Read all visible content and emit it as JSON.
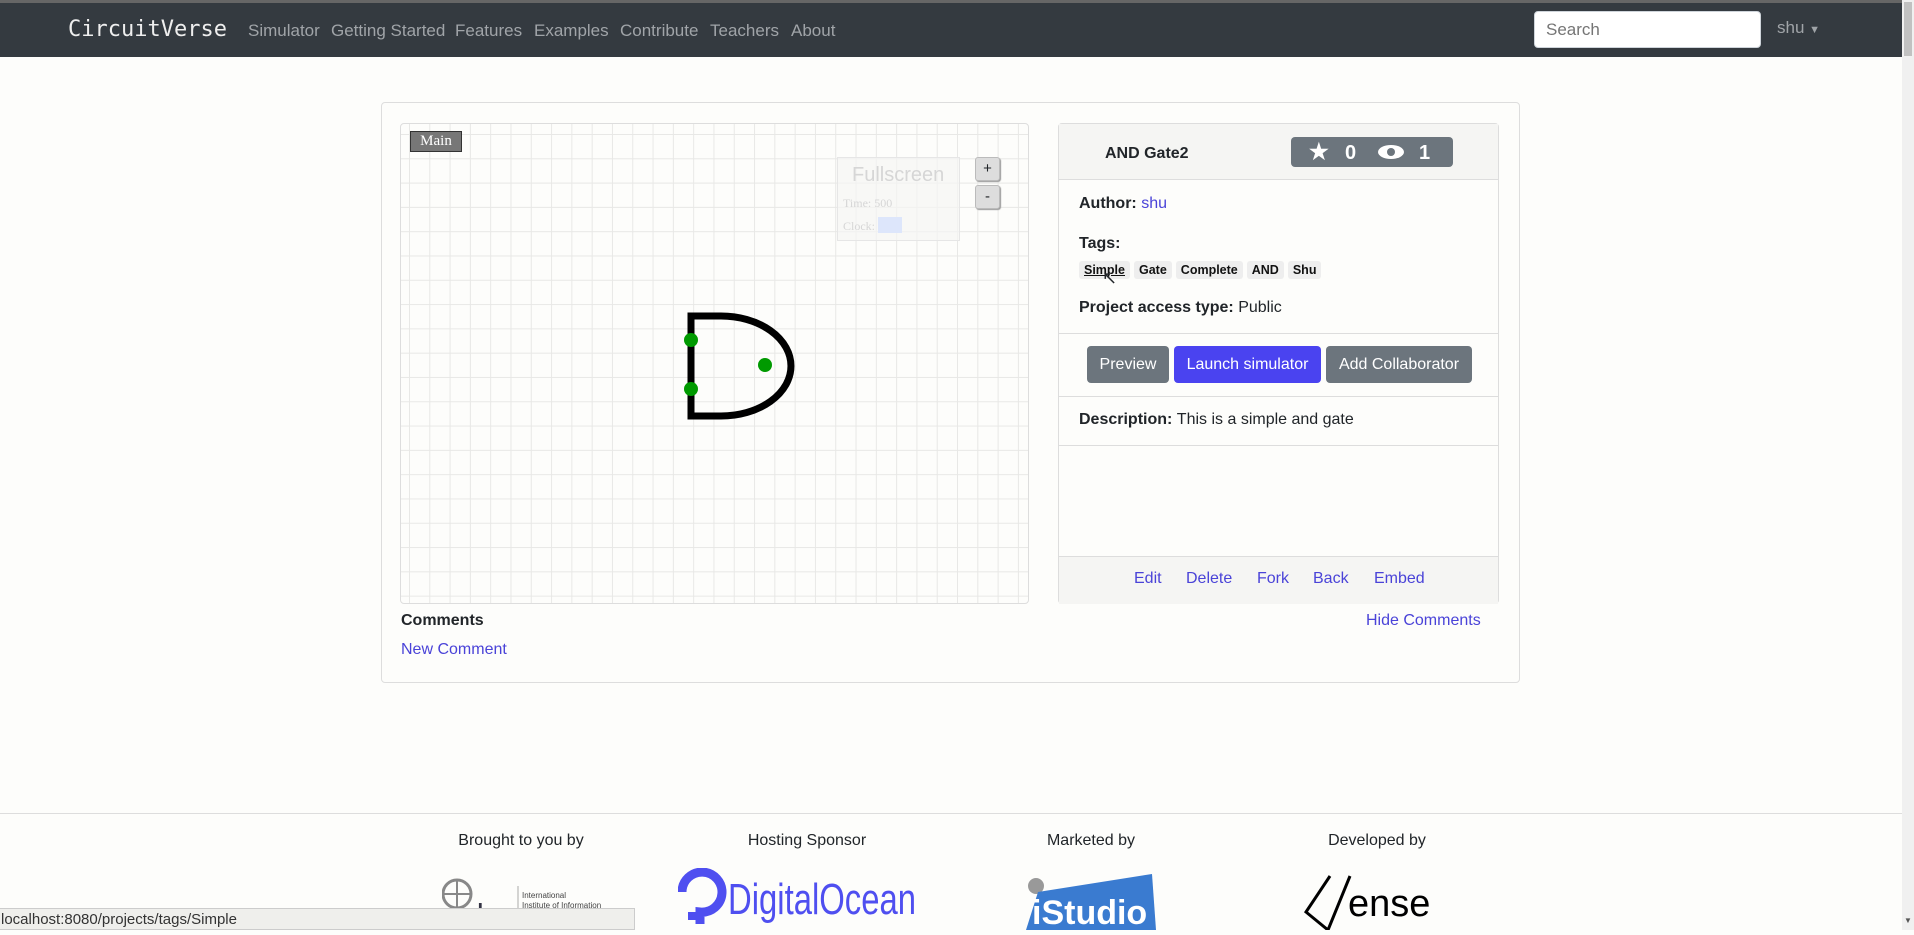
{
  "navbar": {
    "brand": "CircuitVerse",
    "items": [
      "Simulator",
      "Getting Started",
      "Features",
      "Examples",
      "Contribute",
      "Teachers",
      "About"
    ],
    "search_placeholder": "Search",
    "user": "shu"
  },
  "canvas": {
    "tab": "Main",
    "fullscreen": "Fullscreen",
    "time_label": "Time:",
    "time_value": "500",
    "clock_label": "Clock:",
    "zoom_in": "+",
    "zoom_out": "-"
  },
  "project": {
    "title": "AND Gate2",
    "stars": "0",
    "views": "1",
    "author_label": "Author:",
    "author": "shu",
    "tags_label": "Tags:",
    "tags": [
      "Simple",
      "Gate",
      "Complete",
      "AND",
      "Shu"
    ],
    "access_label": "Project access type:",
    "access": "Public",
    "description_label": "Description:",
    "description": "This is a simple and gate",
    "buttons": {
      "preview": "Preview",
      "launch": "Launch simulator",
      "collab": "Add Collaborator"
    },
    "footer_links": [
      "Edit",
      "Delete",
      "Fork",
      "Back",
      "Embed"
    ]
  },
  "comments": {
    "title": "Comments",
    "new": "New Comment",
    "hide": "Hide Comments"
  },
  "footer": {
    "headings": [
      "Brought to you by",
      "Hosting Sponsor",
      "Marketed by",
      "Developed by"
    ],
    "logos": [
      "IIIT",
      "DigitalOcean",
      "iStudio",
      "Vense"
    ]
  },
  "status_url": "localhost:8080/projects/tags/Simple",
  "colors": {
    "navbar": "#343a40",
    "primary": "#4a43f0",
    "secondary": "#6c757d",
    "pin": "#009a00"
  }
}
